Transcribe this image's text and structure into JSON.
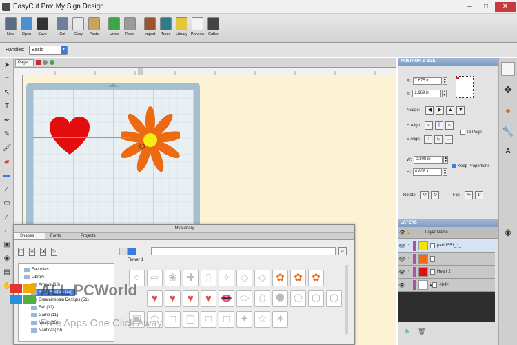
{
  "window": {
    "title": "EasyCut Pro: My Sign Design"
  },
  "toolbar": [
    {
      "label": "New",
      "icon": "new-icon",
      "color": "#5c6b84"
    },
    {
      "label": "Open",
      "icon": "open-icon",
      "color": "#4b8fd3"
    },
    {
      "label": "Save",
      "icon": "save-icon",
      "color": "#333"
    },
    {
      "label": "Cut",
      "icon": "cut-icon",
      "color": "#6f7f99"
    },
    {
      "label": "Copy",
      "icon": "copy-icon",
      "color": "#e8e8e8"
    },
    {
      "label": "Paste",
      "icon": "paste-icon",
      "color": "#c9a45b"
    },
    {
      "label": "Undo",
      "icon": "undo-icon",
      "color": "#3aa64a"
    },
    {
      "label": "Redo",
      "icon": "redo-icon",
      "color": "#9a9a9a"
    },
    {
      "label": "Import",
      "icon": "import-icon",
      "color": "#a0522d"
    },
    {
      "label": "Trace",
      "icon": "trace-icon",
      "color": "#2d7d8c"
    },
    {
      "label": "Library",
      "icon": "library-icon",
      "color": "#e5c73a"
    },
    {
      "label": "Preview",
      "icon": "preview-icon",
      "color": "#f2f2f2"
    },
    {
      "label": "Cutter",
      "icon": "cutter-icon",
      "color": "#444"
    }
  ],
  "handles": {
    "label": "Handles:",
    "value": "Basic"
  },
  "doc": {
    "tab": "Page 1"
  },
  "position_size": {
    "title": "POSITION & SIZE",
    "x_label": "X:",
    "x_value": "7.675 in",
    "y_label": "Y:",
    "y_value": "2.969 in",
    "nudge_label": "Nudge:",
    "halign_label": "H Align:",
    "to_page": "To Page",
    "valign_label": "V Align:",
    "w_label": "W:",
    "w_value": "0.808 in",
    "h_label": "H:",
    "h_value": "0.808 in",
    "keep_proportions": "Keep Proportions",
    "rotate_label": "Rotate:",
    "flip_label": "Flip:"
  },
  "layers": {
    "title": "LAYERS",
    "column": "Layer Name",
    "rows": [
      {
        "name": "path1551_1_",
        "color": "#f2e600",
        "selected": true
      },
      {
        "name": "",
        "color": "#f06a10",
        "selected": false
      },
      {
        "name": "Heart 2",
        "color": "#e01010",
        "selected": false
      },
      {
        "name": "<8-f>",
        "color": "#ffffff",
        "selected": false
      }
    ]
  },
  "library": {
    "title": "My Library",
    "tabs": [
      "Shapes",
      "Fonts",
      "Projects"
    ],
    "section": "Flower 1",
    "tree": [
      "Favorites",
      "Library",
      "Arrows (18)",
      "Basic Shapes (44)",
      "Createinspain Designs (51)",
      "Fall (12)",
      "Game (11)",
      "Music (10)",
      "Nautical (29)"
    ]
  },
  "watermark": {
    "line1": "ALL PCWorld",
    "line2": "Free Apps One Click Away"
  }
}
